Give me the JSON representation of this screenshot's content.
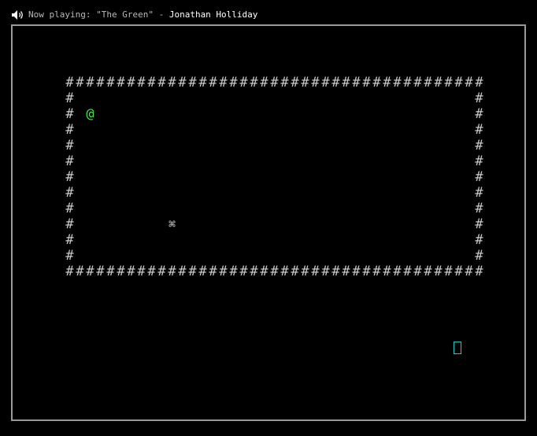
{
  "status_bar": {
    "icon": "speaker-icon",
    "label": "Now playing: ",
    "track": "\"The Green\"",
    "separator": " - ",
    "artist": "Jonathan Holliday"
  },
  "map": {
    "wall_glyph": "#",
    "player_glyph": "@",
    "item_glyph": "⌘",
    "room_cols": 41,
    "room_rows": 13,
    "player_cell": [
      2,
      2
    ],
    "item_cell": [
      10,
      9
    ]
  },
  "colors": {
    "background": "#000000",
    "wall": "#c8c8c8",
    "player": "#3ee83e",
    "cursor": "#1fc9c9",
    "border": "#9a9a9a"
  }
}
